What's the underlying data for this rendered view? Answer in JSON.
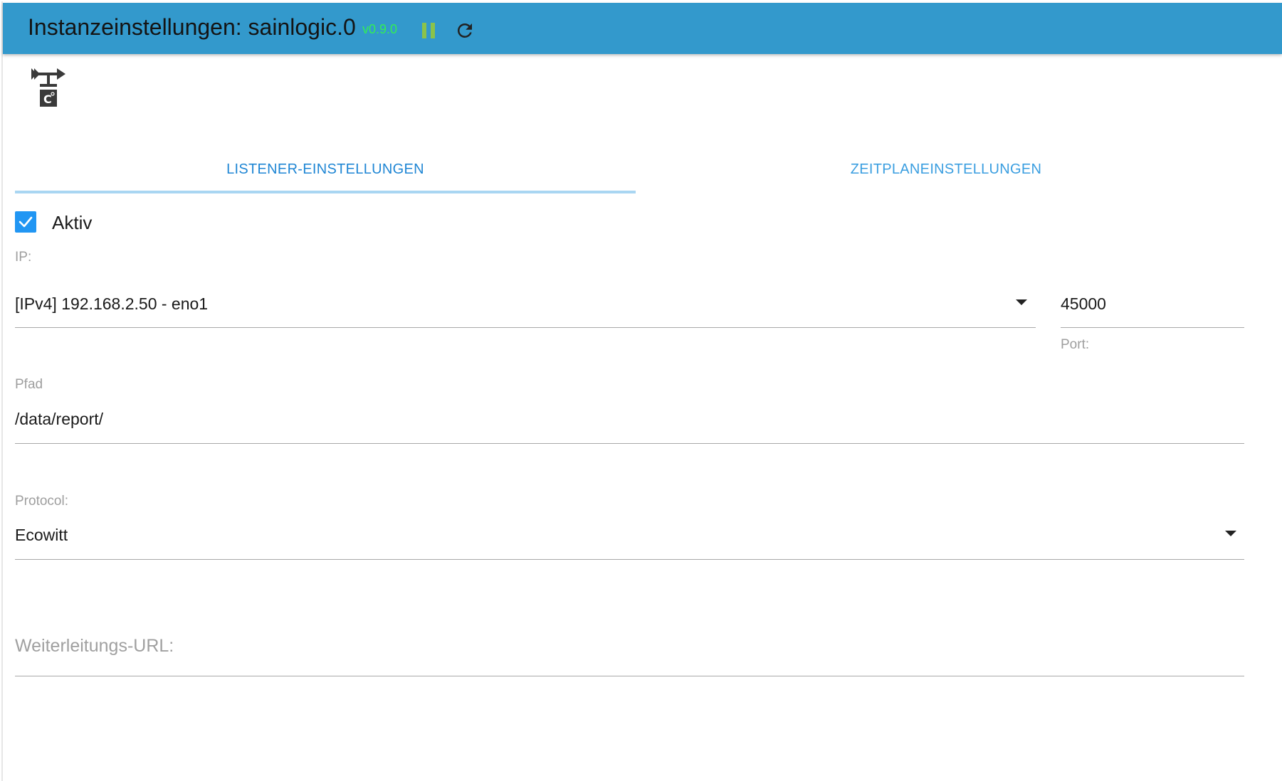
{
  "header": {
    "title": "Instanzeinstellungen: sainlogic.0",
    "version": "v0.9.0",
    "pause_icon": "pause-icon",
    "reload_icon": "reload-icon",
    "bar_color": "#3399cc",
    "version_color": "#33ee55",
    "pause_color": "#8bc34a"
  },
  "logo": {
    "icon": "weather-vane-logo"
  },
  "tabs": [
    {
      "label": "LISTENER-EINSTELLUNGEN",
      "active": true
    },
    {
      "label": "ZEITPLANEINSTELLUNGEN",
      "active": false
    }
  ],
  "form": {
    "aktiv": {
      "label": "Aktiv",
      "checked": true
    },
    "ip": {
      "label": "IP:",
      "value": "[IPv4] 192.168.2.50 - eno1"
    },
    "port": {
      "label": "Port:",
      "value": "45000"
    },
    "pfad": {
      "label": "Pfad",
      "value": "/data/report/"
    },
    "protocol": {
      "label": "Protocol:",
      "value": "Ecowitt"
    },
    "forward_url": {
      "placeholder": "Weiterleitungs-URL:",
      "value": ""
    }
  },
  "colors": {
    "accent": "#2196f3",
    "tab_text": "#3a9ee0",
    "tab_indicator": "#a9d6f2"
  }
}
